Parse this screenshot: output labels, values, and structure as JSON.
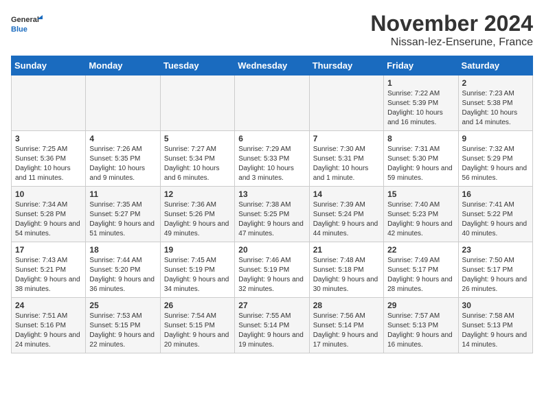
{
  "logo": {
    "general": "General",
    "blue": "Blue"
  },
  "title": "November 2024",
  "location": "Nissan-lez-Enserune, France",
  "weekdays": [
    "Sunday",
    "Monday",
    "Tuesday",
    "Wednesday",
    "Thursday",
    "Friday",
    "Saturday"
  ],
  "weeks": [
    [
      {
        "day": "",
        "info": ""
      },
      {
        "day": "",
        "info": ""
      },
      {
        "day": "",
        "info": ""
      },
      {
        "day": "",
        "info": ""
      },
      {
        "day": "",
        "info": ""
      },
      {
        "day": "1",
        "info": "Sunrise: 7:22 AM\nSunset: 5:39 PM\nDaylight: 10 hours and 16 minutes."
      },
      {
        "day": "2",
        "info": "Sunrise: 7:23 AM\nSunset: 5:38 PM\nDaylight: 10 hours and 14 minutes."
      }
    ],
    [
      {
        "day": "3",
        "info": "Sunrise: 7:25 AM\nSunset: 5:36 PM\nDaylight: 10 hours and 11 minutes."
      },
      {
        "day": "4",
        "info": "Sunrise: 7:26 AM\nSunset: 5:35 PM\nDaylight: 10 hours and 9 minutes."
      },
      {
        "day": "5",
        "info": "Sunrise: 7:27 AM\nSunset: 5:34 PM\nDaylight: 10 hours and 6 minutes."
      },
      {
        "day": "6",
        "info": "Sunrise: 7:29 AM\nSunset: 5:33 PM\nDaylight: 10 hours and 3 minutes."
      },
      {
        "day": "7",
        "info": "Sunrise: 7:30 AM\nSunset: 5:31 PM\nDaylight: 10 hours and 1 minute."
      },
      {
        "day": "8",
        "info": "Sunrise: 7:31 AM\nSunset: 5:30 PM\nDaylight: 9 hours and 59 minutes."
      },
      {
        "day": "9",
        "info": "Sunrise: 7:32 AM\nSunset: 5:29 PM\nDaylight: 9 hours and 56 minutes."
      }
    ],
    [
      {
        "day": "10",
        "info": "Sunrise: 7:34 AM\nSunset: 5:28 PM\nDaylight: 9 hours and 54 minutes."
      },
      {
        "day": "11",
        "info": "Sunrise: 7:35 AM\nSunset: 5:27 PM\nDaylight: 9 hours and 51 minutes."
      },
      {
        "day": "12",
        "info": "Sunrise: 7:36 AM\nSunset: 5:26 PM\nDaylight: 9 hours and 49 minutes."
      },
      {
        "day": "13",
        "info": "Sunrise: 7:38 AM\nSunset: 5:25 PM\nDaylight: 9 hours and 47 minutes."
      },
      {
        "day": "14",
        "info": "Sunrise: 7:39 AM\nSunset: 5:24 PM\nDaylight: 9 hours and 44 minutes."
      },
      {
        "day": "15",
        "info": "Sunrise: 7:40 AM\nSunset: 5:23 PM\nDaylight: 9 hours and 42 minutes."
      },
      {
        "day": "16",
        "info": "Sunrise: 7:41 AM\nSunset: 5:22 PM\nDaylight: 9 hours and 40 minutes."
      }
    ],
    [
      {
        "day": "17",
        "info": "Sunrise: 7:43 AM\nSunset: 5:21 PM\nDaylight: 9 hours and 38 minutes."
      },
      {
        "day": "18",
        "info": "Sunrise: 7:44 AM\nSunset: 5:20 PM\nDaylight: 9 hours and 36 minutes."
      },
      {
        "day": "19",
        "info": "Sunrise: 7:45 AM\nSunset: 5:19 PM\nDaylight: 9 hours and 34 minutes."
      },
      {
        "day": "20",
        "info": "Sunrise: 7:46 AM\nSunset: 5:19 PM\nDaylight: 9 hours and 32 minutes."
      },
      {
        "day": "21",
        "info": "Sunrise: 7:48 AM\nSunset: 5:18 PM\nDaylight: 9 hours and 30 minutes."
      },
      {
        "day": "22",
        "info": "Sunrise: 7:49 AM\nSunset: 5:17 PM\nDaylight: 9 hours and 28 minutes."
      },
      {
        "day": "23",
        "info": "Sunrise: 7:50 AM\nSunset: 5:17 PM\nDaylight: 9 hours and 26 minutes."
      }
    ],
    [
      {
        "day": "24",
        "info": "Sunrise: 7:51 AM\nSunset: 5:16 PM\nDaylight: 9 hours and 24 minutes."
      },
      {
        "day": "25",
        "info": "Sunrise: 7:53 AM\nSunset: 5:15 PM\nDaylight: 9 hours and 22 minutes."
      },
      {
        "day": "26",
        "info": "Sunrise: 7:54 AM\nSunset: 5:15 PM\nDaylight: 9 hours and 20 minutes."
      },
      {
        "day": "27",
        "info": "Sunrise: 7:55 AM\nSunset: 5:14 PM\nDaylight: 9 hours and 19 minutes."
      },
      {
        "day": "28",
        "info": "Sunrise: 7:56 AM\nSunset: 5:14 PM\nDaylight: 9 hours and 17 minutes."
      },
      {
        "day": "29",
        "info": "Sunrise: 7:57 AM\nSunset: 5:13 PM\nDaylight: 9 hours and 16 minutes."
      },
      {
        "day": "30",
        "info": "Sunrise: 7:58 AM\nSunset: 5:13 PM\nDaylight: 9 hours and 14 minutes."
      }
    ]
  ]
}
